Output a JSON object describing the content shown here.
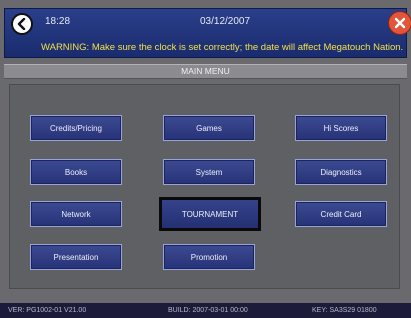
{
  "header": {
    "time": "18:28",
    "date": "03/12/2007",
    "warning": "WARNING: Make sure the clock is set correctly; the date will affect Megatouch Nation."
  },
  "menu_title": "MAIN MENU",
  "buttons": {
    "credits_pricing": "Credits/Pricing",
    "games": "Games",
    "hi_scores": "Hi Scores",
    "books": "Books",
    "system": "System",
    "diagnostics": "Diagnostics",
    "network": "Network",
    "tournament": "TOURNAMENT",
    "credit_card": "Credit Card",
    "presentation": "Presentation",
    "promotion": "Promotion"
  },
  "footer": {
    "ver": "VER: PG1002-01 V21.00",
    "build": "BUILD: 2007-03-01 00:00",
    "key": "KEY: SA3S29 01800"
  },
  "icons": {
    "back": "back-arrow-icon",
    "close": "close-icon"
  },
  "colors": {
    "warning_text": "#f2e04a",
    "button_fill": "#2f3c86",
    "close_button": "#e2553a"
  }
}
